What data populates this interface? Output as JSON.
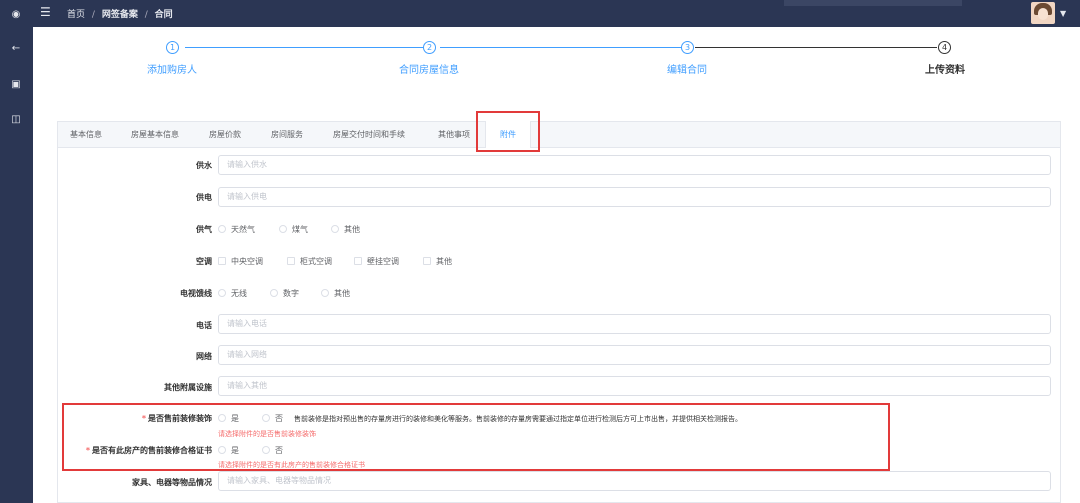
{
  "breadcrumb": {
    "home": "首页",
    "section": "网签备案",
    "current": "合同",
    "sep": "/"
  },
  "steps": [
    {
      "num": "1",
      "label": "添加购房人"
    },
    {
      "num": "2",
      "label": "合同房屋信息"
    },
    {
      "num": "3",
      "label": "编辑合同"
    },
    {
      "num": "4",
      "label": "上传资料"
    }
  ],
  "tabs": [
    "基本信息",
    "房屋基本信息",
    "房屋价款",
    "房间服务",
    "房屋交付时间和手续",
    "其他事项",
    "附件"
  ],
  "active_tab": "附件",
  "form": {
    "water": {
      "label": "供水",
      "placeholder": "请输入供水"
    },
    "power": {
      "label": "供电",
      "placeholder": "请输入供电"
    },
    "gas": {
      "label": "供气",
      "options": [
        "天然气",
        "煤气",
        "其他"
      ]
    },
    "ac": {
      "label": "空调",
      "options": [
        "中央空调",
        "柜式空调",
        "壁挂空调",
        "其他"
      ]
    },
    "tv": {
      "label": "电视馈线",
      "options": [
        "无线",
        "数字",
        "其他"
      ]
    },
    "phone": {
      "label": "电话",
      "placeholder": "请输入电话"
    },
    "network": {
      "label": "网络",
      "placeholder": "请输入网络"
    },
    "other_facility": {
      "label": "其他附属设施",
      "placeholder": "请输入其他"
    },
    "decoration": {
      "label": "是否售前装修装饰",
      "yes": "是",
      "no": "否",
      "note": "售前装修是指对预出售的存量房进行的装修和美化等服务。售前装修的存量房需要通过指定单位进行检测后方可上市出售，并提供相关检测报告。",
      "error": "请选择附件的是否售前装修装饰"
    },
    "certificate": {
      "label": "是否有此房产的售前装修合格证书",
      "yes": "是",
      "no": "否",
      "error": "请选择附件的是否有此房产的售前装修合格证书"
    },
    "furniture": {
      "label": "家具、电器等物品情况",
      "placeholder": "请输入家具、电器等物品情况"
    }
  },
  "colors": {
    "accent": "#409eff",
    "nav": "#2b3654",
    "error": "#f56c6c",
    "highlight": "#e23a3a"
  }
}
